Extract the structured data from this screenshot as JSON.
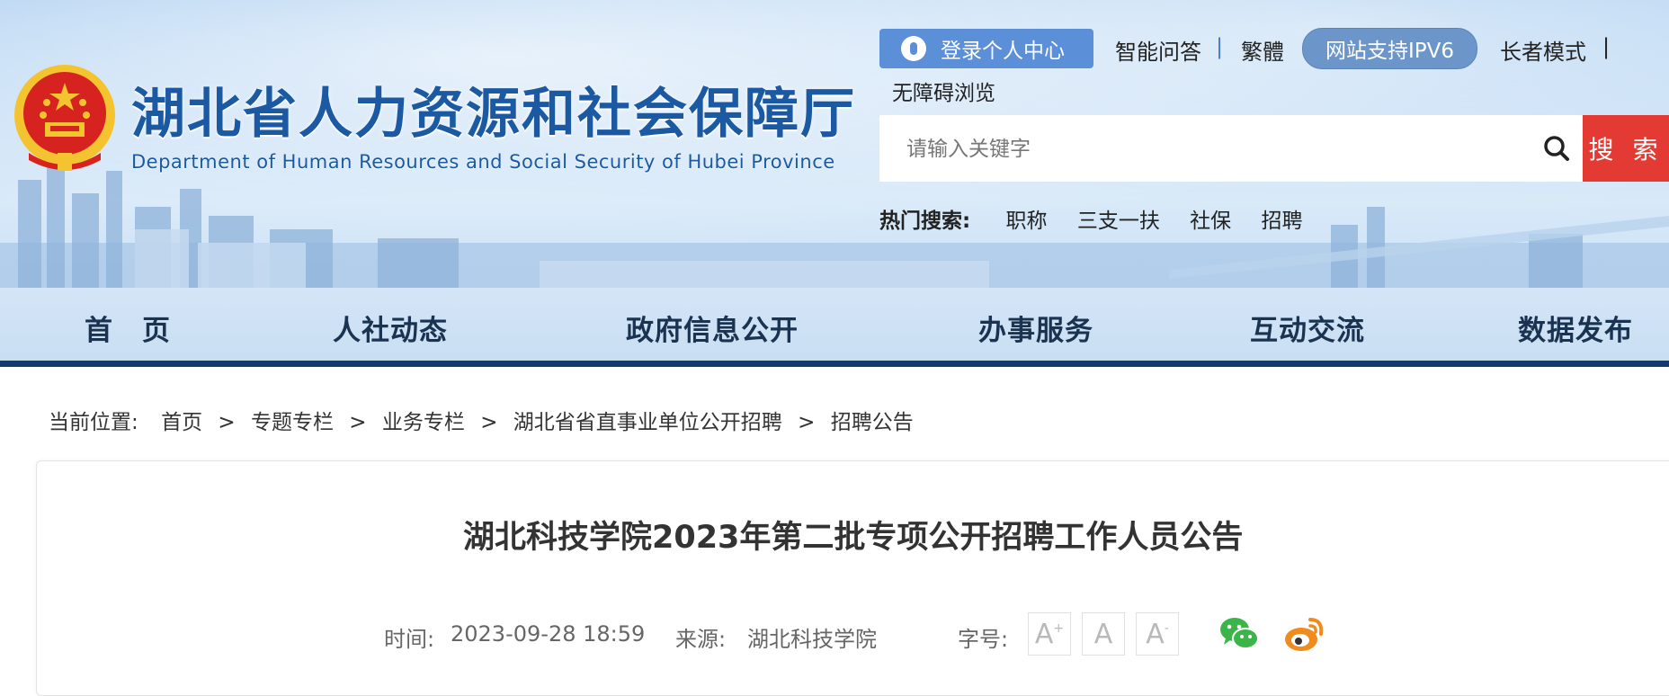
{
  "header": {
    "title": "湖北省人力资源和社会保障厅",
    "subtitle": "Department of Human Resources and Social Security of Hubei Province",
    "login_label": "登录个人中心",
    "links": [
      "智能问答",
      "繁體",
      "长者模式",
      "无障碍浏览"
    ],
    "separator": "|",
    "ipv6_label": "网站支持IPV6",
    "search": {
      "placeholder": "请输入关键字",
      "button_label": "搜 索"
    },
    "hot": {
      "label": "热门搜索:",
      "items": [
        "职称",
        "三支一扶",
        "社保",
        "招聘"
      ]
    }
  },
  "nav": {
    "items": [
      "首　页",
      "人社动态",
      "政府信息公开",
      "办事服务",
      "互动交流",
      "数据发布"
    ]
  },
  "breadcrumb": {
    "label": "当前位置:",
    "separator": ">",
    "items": [
      "首页",
      "专题专栏",
      "业务专栏",
      "湖北省省直事业单位公开招聘",
      "招聘公告"
    ]
  },
  "article": {
    "title": "湖北科技学院2023年第二批专项公开招聘工作人员公告",
    "time_label": "时间:",
    "time": "2023-09-28 18:59",
    "source_label": "来源:",
    "source": "湖北科技学院",
    "fontsize_label": "字号:",
    "fontsize_buttons": [
      "A",
      "A",
      "A"
    ]
  },
  "colors": {
    "brand_blue": "#1b5aa3",
    "search_red": "#e33b34",
    "nav_border": "#123a6f",
    "login_bg": "#5b8fd8",
    "wechat_green": "#3bb54a",
    "weibo_orange": "#f08b1e"
  }
}
